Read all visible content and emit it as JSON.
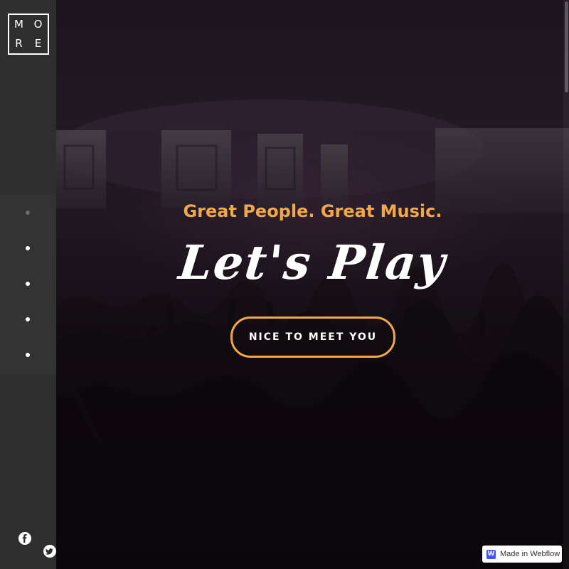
{
  "logo": {
    "letters": [
      "M",
      "O",
      "R",
      "E"
    ]
  },
  "hero": {
    "subtitle": "Great People. Great Music.",
    "title": "Let's Play",
    "cta_label": "NICE TO MEET YOU"
  },
  "nav_dots": {
    "count": 5,
    "active_index": 0
  },
  "social": {
    "icons": [
      "facebook-icon",
      "twitter-icon"
    ]
  },
  "badge": {
    "icon_letter": "W",
    "label": "Made in Webflow"
  },
  "colors": {
    "accent": "#f2a844",
    "sidebar": "#2e2e2e",
    "dots_panel": "#333333",
    "text": "#ffffff"
  }
}
